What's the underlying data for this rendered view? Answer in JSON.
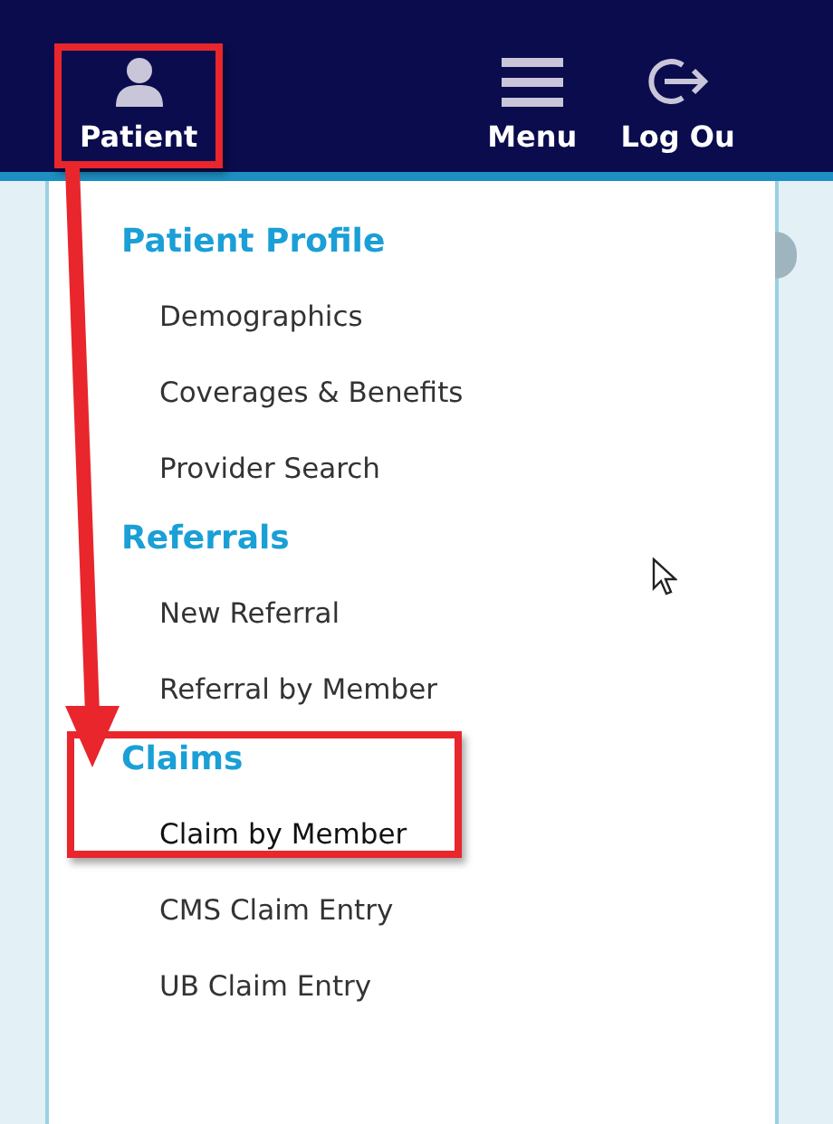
{
  "nav": [
    {
      "label": "Patient",
      "highlighted": true
    },
    {
      "label": "Menu",
      "highlighted": false
    },
    {
      "label": "Log Ou",
      "highlighted": false
    }
  ],
  "dropdown": {
    "sections": [
      {
        "title": "Patient Profile",
        "highlighted": false,
        "items": [
          {
            "label": "Demographics",
            "highlighted": false
          },
          {
            "label": "Coverages & Benefits",
            "highlighted": false
          },
          {
            "label": "Provider Search",
            "highlighted": false
          }
        ]
      },
      {
        "title": "Referrals",
        "highlighted": false,
        "items": [
          {
            "label": "New Referral",
            "highlighted": false
          },
          {
            "label": "Referral by Member",
            "highlighted": false
          }
        ]
      },
      {
        "title": "Claims",
        "highlighted": true,
        "items": [
          {
            "label": "Claim by Member",
            "highlighted": true
          },
          {
            "label": "CMS Claim Entry",
            "highlighted": false
          },
          {
            "label": "UB Claim Entry",
            "highlighted": false
          }
        ]
      }
    ]
  }
}
